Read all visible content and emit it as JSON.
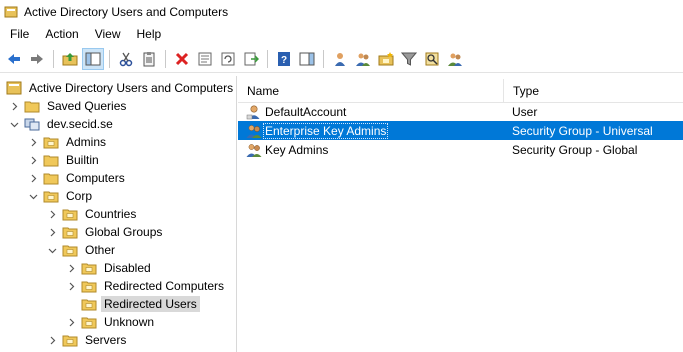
{
  "window": {
    "title": "Active Directory Users and Computers"
  },
  "menu": [
    "File",
    "Action",
    "View",
    "Help"
  ],
  "toolbar": {
    "icons": [
      "back-arrow-icon",
      "forward-arrow-icon",
      "up-folder-icon",
      "show-hide-console-tree-icon",
      "cut-icon",
      "clipboard-icon",
      "delete-icon",
      "properties-icon",
      "refresh-icon",
      "export-list-icon",
      "help-icon",
      "show-action-pane-icon",
      "new-user-icon",
      "new-group-icon",
      "new-ou-icon",
      "filter-icon",
      "find-icon",
      "add-to-group-icon"
    ]
  },
  "tree": {
    "root": "Active Directory Users and Computers [",
    "items": [
      {
        "label": "Saved Queries",
        "level": 1,
        "expander": "collapsed",
        "kind": "folder"
      },
      {
        "label": "dev.secid.se",
        "level": 1,
        "expander": "expanded",
        "kind": "domain"
      },
      {
        "label": "Admins",
        "level": 2,
        "expander": "collapsed",
        "kind": "ou"
      },
      {
        "label": "Builtin",
        "level": 2,
        "expander": "collapsed",
        "kind": "folder"
      },
      {
        "label": "Computers",
        "level": 2,
        "expander": "collapsed",
        "kind": "folder"
      },
      {
        "label": "Corp",
        "level": 2,
        "expander": "expanded",
        "kind": "ou"
      },
      {
        "label": "Countries",
        "level": 3,
        "expander": "collapsed",
        "kind": "ou"
      },
      {
        "label": "Global Groups",
        "level": 3,
        "expander": "collapsed",
        "kind": "ou"
      },
      {
        "label": "Other",
        "level": 3,
        "expander": "expanded",
        "kind": "ou"
      },
      {
        "label": "Disabled",
        "level": 4,
        "expander": "collapsed",
        "kind": "ou"
      },
      {
        "label": "Redirected Computers",
        "level": 4,
        "expander": "collapsed",
        "kind": "ou"
      },
      {
        "label": "Redirected Users",
        "level": 4,
        "expander": "none",
        "kind": "ou",
        "selected": true
      },
      {
        "label": "Unknown",
        "level": 4,
        "expander": "collapsed",
        "kind": "ou"
      },
      {
        "label": "Servers",
        "level": 3,
        "expander": "collapsed",
        "kind": "ou"
      }
    ]
  },
  "list": {
    "columns": [
      "Name",
      "Type"
    ],
    "rows": [
      {
        "name": "DefaultAccount",
        "type": "User",
        "icon": "user-icon"
      },
      {
        "name": "Enterprise Key Admins",
        "type": "Security Group - Universal",
        "icon": "group-icon",
        "selected": true
      },
      {
        "name": "Key Admins",
        "type": "Security Group - Global",
        "icon": "group-icon"
      }
    ]
  },
  "colors": {
    "selection": "#0078d7",
    "tree_selection": "#d9d9d9",
    "folder": "#f0c85a"
  }
}
